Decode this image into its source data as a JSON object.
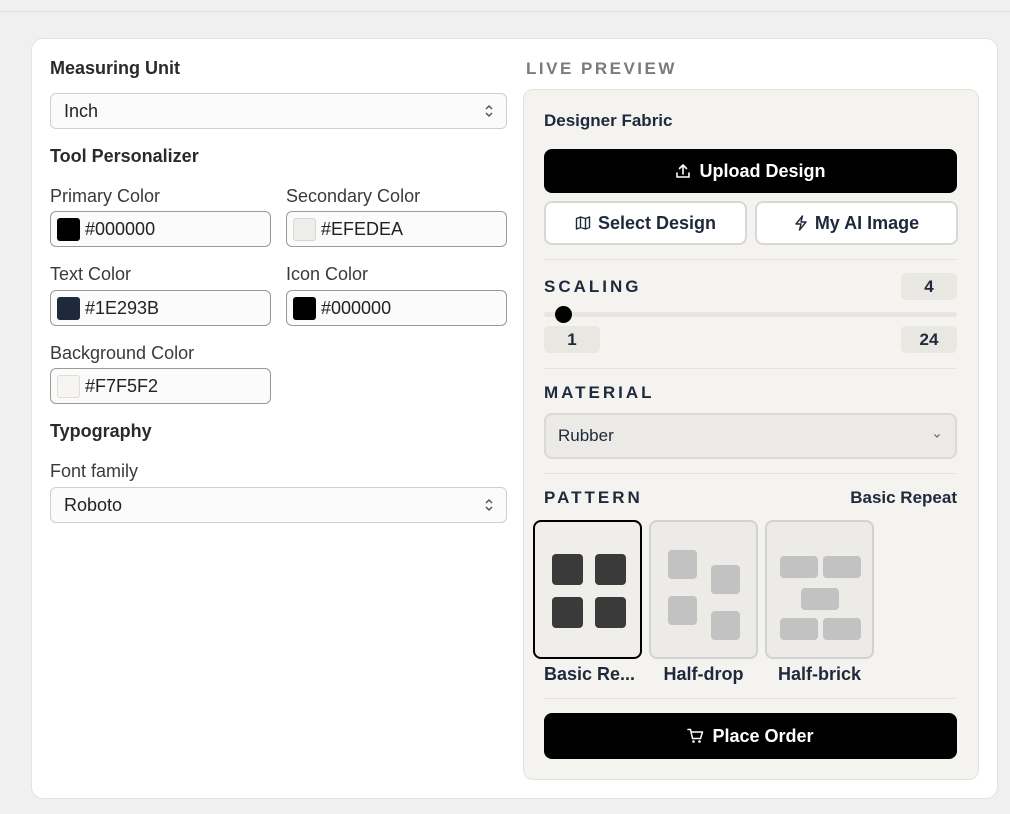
{
  "settings": {
    "measuring_unit_label": "Measuring Unit",
    "measuring_unit_value": "Inch",
    "tool_personalizer_label": "Tool Personalizer",
    "primary_color": {
      "label": "Primary Color",
      "value": "#000000"
    },
    "secondary_color": {
      "label": "Secondary Color",
      "value": "#EFEDEA"
    },
    "text_color": {
      "label": "Text Color",
      "value": "#1E293B"
    },
    "icon_color": {
      "label": "Icon Color",
      "value": "#000000"
    },
    "background_color": {
      "label": "Background Color",
      "value": "#F7F5F2"
    },
    "typography_label": "Typography",
    "font_family_label": "Font family",
    "font_family_value": "Roboto"
  },
  "preview": {
    "heading": "LIVE PREVIEW",
    "product_title": "Designer Fabric",
    "upload_label": "Upload Design",
    "select_design_label": "Select Design",
    "ai_image_label": "My AI Image",
    "scaling_label": "SCALING",
    "scaling_value": "4",
    "scaling_min": "1",
    "scaling_max": "24",
    "material_label": "MATERIAL",
    "material_value": "Rubber",
    "pattern_label": "PATTERN",
    "pattern_selected": "Basic Repeat",
    "patterns": [
      "Basic Re...",
      "Half-drop",
      "Half-brick"
    ],
    "place_order_label": "Place Order"
  },
  "colors": {
    "button_bg": "#000000",
    "text": "#1E293B",
    "panel_bg": "#F4F3F0"
  }
}
